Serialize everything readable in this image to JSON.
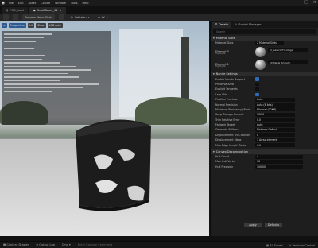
{
  "menu": {
    "items": [
      "File",
      "Edit",
      "Asset",
      "Collide",
      "Window",
      "Tools",
      "Help"
    ]
  },
  "tabs": [
    {
      "label": "FGD_Load"
    },
    {
      "label": "SmallTower_01"
    }
  ],
  "toolbar": {
    "bake_label": "Bake",
    "remove_label": "Remove Nane Mesh",
    "collision_label": "Collision",
    "lv_label": "LV"
  },
  "viewport": {
    "perspective_label": "Perspective",
    "lit_label": "Lit",
    "show_label": "Show",
    "lod_label": "LOD Auto"
  },
  "details": {
    "tab_details": "Details",
    "tab_socket": "Socket Manager",
    "search_placeholder": "Search",
    "material_section": "Material Slots",
    "material_slots_label": "Material Slots",
    "material_slots_value": "2 Material Slots",
    "element0_label": "Element 0",
    "element0_sub": "Highlight",
    "element0_material": "M_GalacticFrontage",
    "element1_label": "Element 1",
    "element1_sub": "Highlight",
    "element1_material": "MI_Metal_Smooth",
    "nanite_section": "Nanite Settings",
    "rows": [
      {
        "label": "Enable Nanite Support",
        "type": "checkbox",
        "checked": true
      },
      {
        "label": "Preserve Area",
        "type": "checkbox",
        "checked": false
      },
      {
        "label": "Explicit Tangents",
        "type": "checkbox",
        "checked": false
      },
      {
        "label": "Lerp UVs",
        "type": "checkbox",
        "checked": true
      },
      {
        "label": "Position Precision",
        "type": "value",
        "value": "Auto"
      },
      {
        "label": "Normal Precision",
        "type": "value",
        "value": "Auto (8 bits)"
      },
      {
        "label": "Minimum Residency (Root)",
        "type": "value",
        "value": "Minimal (32KB)"
      },
      {
        "label": "Keep Triangle Percent",
        "type": "value",
        "value": "100.0"
      },
      {
        "label": "Trim Relative Error",
        "type": "value",
        "value": "0.0"
      },
      {
        "label": "Fallback Target",
        "type": "value",
        "value": "Auto"
      },
      {
        "label": "Generate Fallback",
        "type": "value",
        "value": "Platform Default"
      },
      {
        "label": "Displacement UV Channel",
        "type": "value",
        "value": "0"
      },
      {
        "label": "Displacement Maps",
        "type": "value",
        "value": "1 Array element"
      },
      {
        "label": "Max Edge Length Factor",
        "type": "value",
        "value": "0.0"
      }
    ],
    "collision_section": "Convex Decomposition",
    "hull_count_label": "Hull Count",
    "hull_count_value": "4",
    "max_hull_verts_label": "Max Hull Verts",
    "max_hull_verts_value": "16",
    "hull_precision_label": "Hull Precision",
    "hull_precision_value": "100000",
    "apply_label": "Apply",
    "defaults_label": "Defaults"
  },
  "statusbar": {
    "content_drawer": "Content Drawer",
    "output_log": "Output Log",
    "cmd": "Cmd",
    "console_placeholder": "Enter Console Command",
    "all_saved": "All Saved",
    "revision_control": "Revision Control"
  }
}
